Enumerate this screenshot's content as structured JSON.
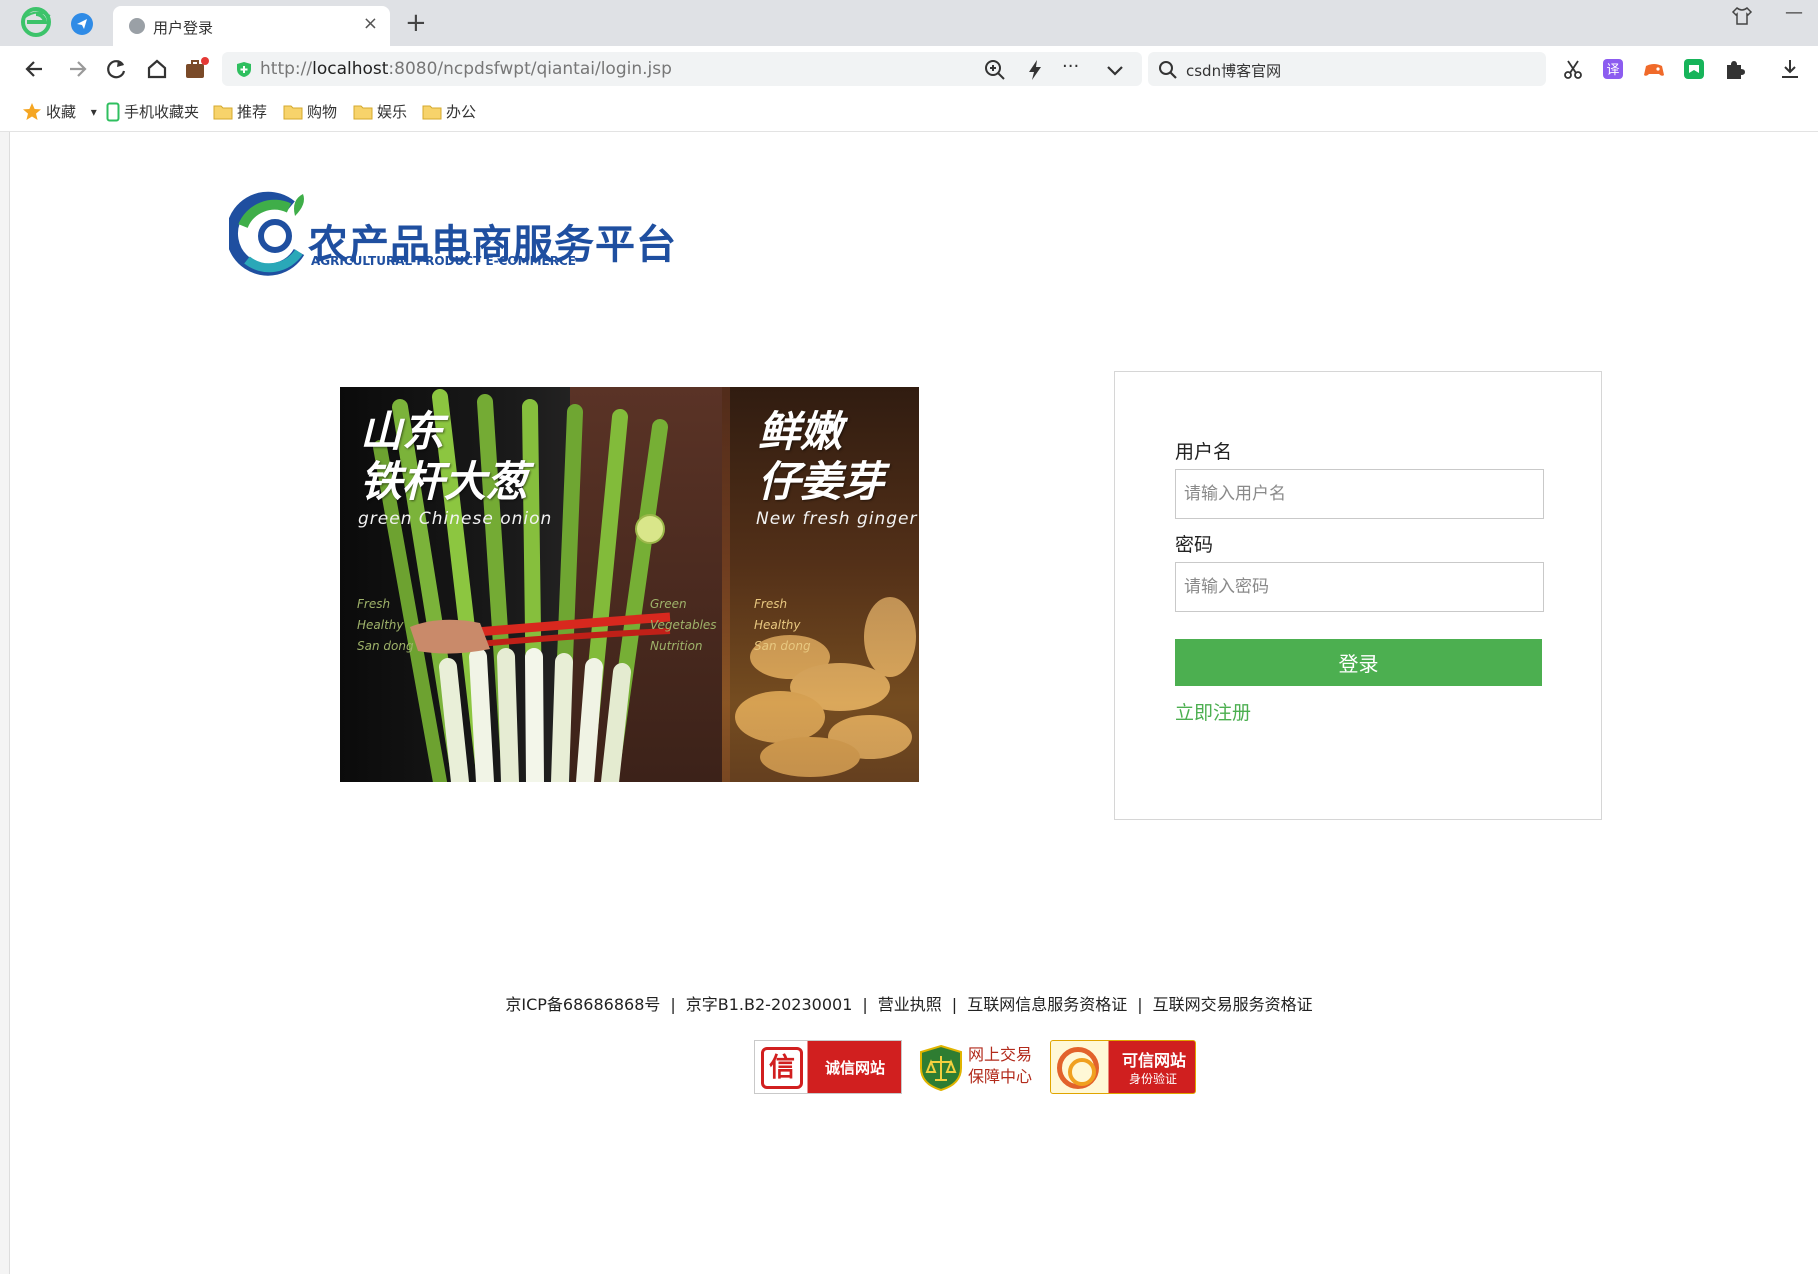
{
  "browser": {
    "tab_title": "用户登录",
    "tab_close": "×",
    "new_tab": "+",
    "minimize": "—",
    "url_protocol": "http://",
    "url_host": "localhost",
    "url_path": ":8080/ncpdsfwpt/qiantai/login.jsp",
    "search_text": "csdn博客官网",
    "more": "···",
    "dropdown": "⌄"
  },
  "bookmarks": {
    "items": [
      {
        "label": "收藏",
        "icon": "star-icon"
      },
      {
        "label": "手机收藏夹",
        "icon": "mobile-icon"
      },
      {
        "label": "推荐",
        "icon": "folder-icon"
      },
      {
        "label": "购物",
        "icon": "folder-icon"
      },
      {
        "label": "娱乐",
        "icon": "folder-icon"
      },
      {
        "label": "办公",
        "icon": "folder-icon"
      }
    ],
    "caret": "▾"
  },
  "logo": {
    "title_cn": "农产品电商服务平台",
    "title_en": "AGRICULTURAL PRODUCT E-COMMERCE"
  },
  "banner": {
    "left_title_1": "山东",
    "left_title_2": "铁杆大葱",
    "left_sub": "green Chinese onion",
    "left_tags": [
      "Fresh",
      "Healthy",
      "San dong"
    ],
    "mid_tags": [
      "Green",
      "Vegetables",
      "Nutrition"
    ],
    "right_title_1": "鲜嫩",
    "right_title_2": "仔姜芽",
    "right_sub": "New fresh ginger",
    "right_tags": [
      "Fresh",
      "Healthy",
      "San dong"
    ]
  },
  "login": {
    "username_label": "用户名",
    "username_placeholder": "请输入用户名",
    "username_value": "",
    "password_label": "密码",
    "password_placeholder": "请输入密码",
    "password_value": "",
    "submit_label": "登录",
    "register_label": "立即注册"
  },
  "footer": {
    "links": [
      "京ICP备68686868号",
      "京字B1.B2-20230001",
      "营业执照",
      "互联网信息服务资格证",
      "互联网交易服务资格证"
    ],
    "separator": "|",
    "badge_a": {
      "glyph": "信",
      "text": "诚信网站"
    },
    "badge_b": {
      "line1": "网上交易",
      "line2": "保障中心"
    },
    "badge_c": {
      "line1": "可信网站",
      "line2": "身份验证"
    }
  },
  "colors": {
    "accent_green": "#4caf50",
    "logo_blue": "#1f4fa0",
    "badge_red": "#d11f1f"
  }
}
